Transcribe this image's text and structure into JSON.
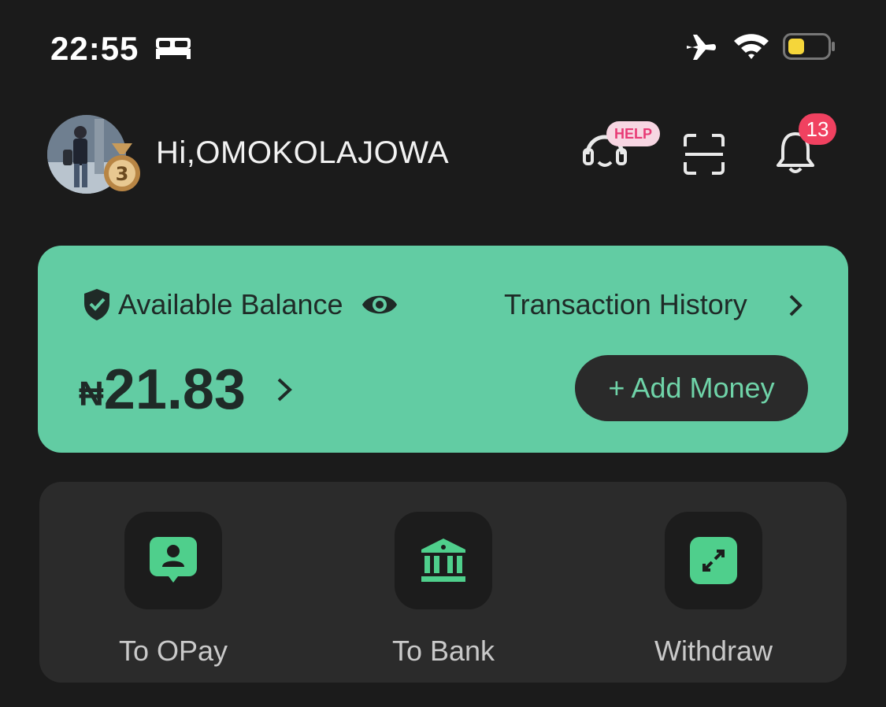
{
  "status_bar": {
    "time": "22:55",
    "icons": [
      "bed-icon",
      "airplane-icon",
      "wifi-icon",
      "battery-icon"
    ]
  },
  "header": {
    "greeting": "Hi,OMOKOLAJOWA",
    "medal_level": "3",
    "help_badge": "HELP",
    "notification_count": "13"
  },
  "balance": {
    "label": "Available Balance",
    "transaction_history": "Transaction History",
    "currency": "₦",
    "amount": "21.83",
    "add_money": "+ Add Money"
  },
  "actions": [
    {
      "label": "To OPay",
      "icon": "contact-icon"
    },
    {
      "label": "To Bank",
      "icon": "bank-icon"
    },
    {
      "label": "Withdraw",
      "icon": "withdraw-icon"
    }
  ],
  "colors": {
    "accent": "#62cca3",
    "badge": "#f04160",
    "background": "#1b1b1b"
  }
}
